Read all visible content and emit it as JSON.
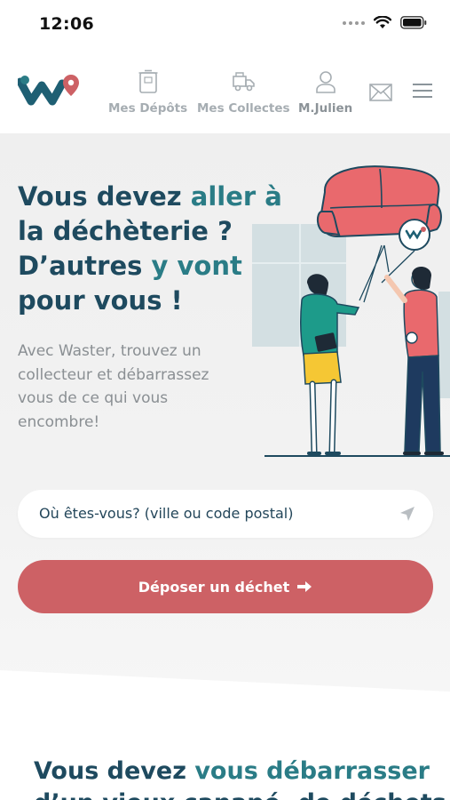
{
  "status_bar": {
    "time": "12:06"
  },
  "nav": {
    "items": [
      {
        "label": "Mes Dépôts",
        "icon": "bin-icon"
      },
      {
        "label": "Mes Collectes",
        "icon": "truck-icon"
      },
      {
        "label": "M.Julien",
        "icon": "user-icon"
      }
    ],
    "mail_icon": "mail-icon",
    "menu_icon": "hamburger-menu-icon"
  },
  "hero": {
    "headline_part1": "Vous devez ",
    "headline_accent1": "aller à",
    "headline_part2": "la déchèterie ?",
    "headline_part3": "D’autres ",
    "headline_accent2": "y vont",
    "headline_part4": "pour vous !",
    "subtext": "Avec Waster, trouvez un collecteur et débarrassez vous de ce qui vous encombre!"
  },
  "search": {
    "placeholder": "Où êtes-vous? (ville ou code postal)"
  },
  "cta": {
    "label": "Déposer un déchet",
    "arrow": "➡"
  },
  "section": {
    "title_part1": "Vous devez ",
    "title_accent": "vous débarrasser",
    "title_part2": "d’un vieux canapé, de déchets"
  },
  "colors": {
    "brand_teal": "#1e4a5f",
    "accent_teal": "#2a7c86",
    "cta_red": "#cd6165",
    "nav_grey": "#a6adb2"
  }
}
